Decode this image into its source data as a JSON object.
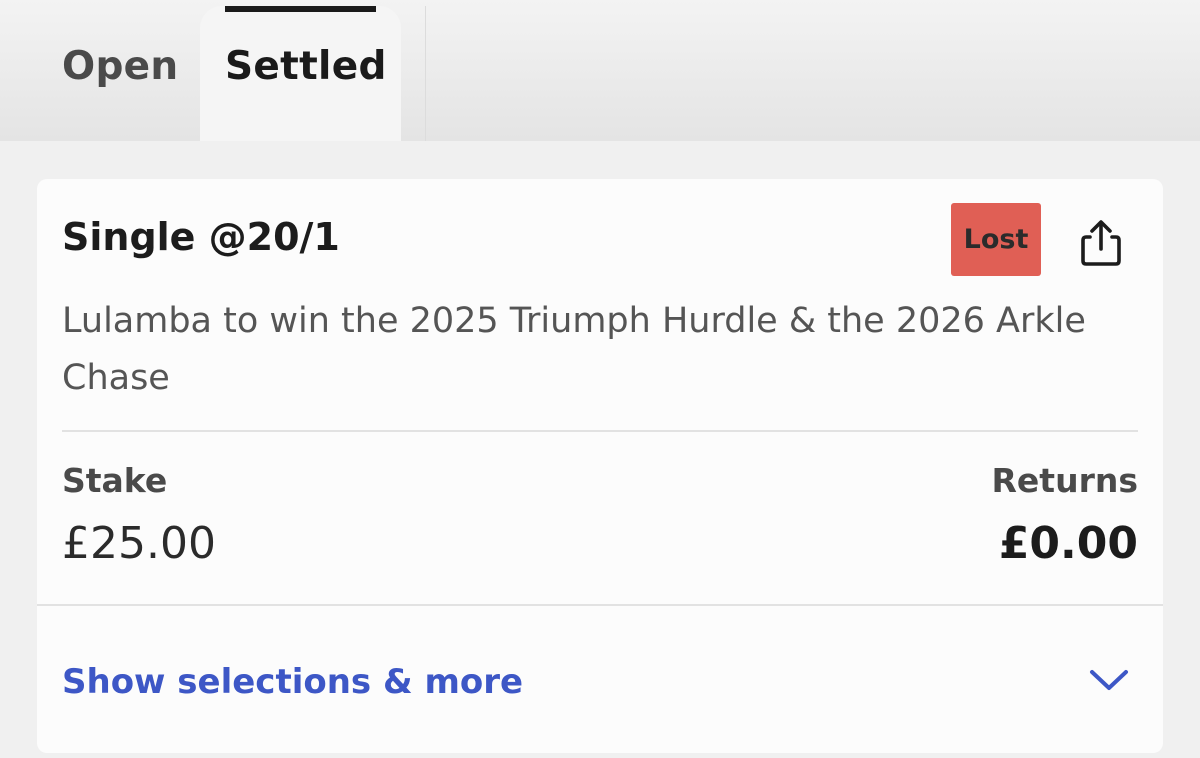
{
  "tabs": {
    "open_label": "Open",
    "settled_label": "Settled",
    "active": "Settled"
  },
  "bet": {
    "type": "Single @20/1",
    "status": "Lost",
    "description": "Lulamba to win the 2025 Triumph Hurdle & the 2026 Arkle Chase",
    "stake_label": "Stake",
    "stake_value": "£25.00",
    "returns_label": "Returns",
    "returns_value": "£0.00",
    "expand_label": "Show selections & more"
  },
  "icons": {
    "share": "share-icon",
    "chevron": "chevron-down-icon"
  },
  "colors": {
    "status_lost": "#e05f55",
    "link": "#3d57c6",
    "active_tab_indicator": "#1a1a1a"
  }
}
